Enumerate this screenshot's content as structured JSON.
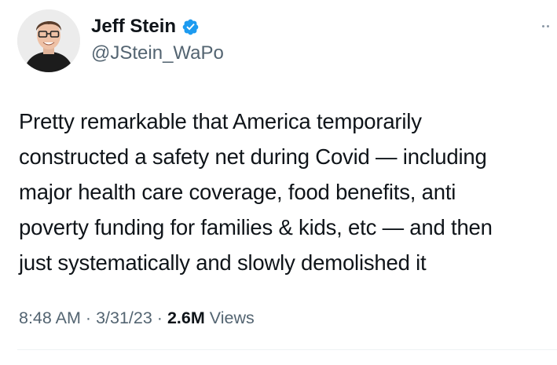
{
  "author": {
    "display_name": "Jeff Stein",
    "handle": "@JStein_WaPo",
    "verified": true,
    "avatar_icon": "person-avatar",
    "verified_icon": "verified-badge-icon",
    "verified_color": "#1d9bf0"
  },
  "tweet": {
    "text": "Pretty remarkable that America temporarily\nconstructed a safety net during Covid — including\nmajor health care coverage, food benefits, anti\npoverty funding for families & kids, etc — and then\njust systematically and slowly demolished it"
  },
  "meta": {
    "time": "8:48 AM",
    "separator": "·",
    "date": "3/31/23",
    "views_count": "2.6M",
    "views_label": "Views"
  },
  "colors": {
    "text_primary": "#0f1419",
    "text_secondary": "#536471",
    "divider": "#eff3f4"
  },
  "menu": {
    "icon": "more-options-icon"
  }
}
